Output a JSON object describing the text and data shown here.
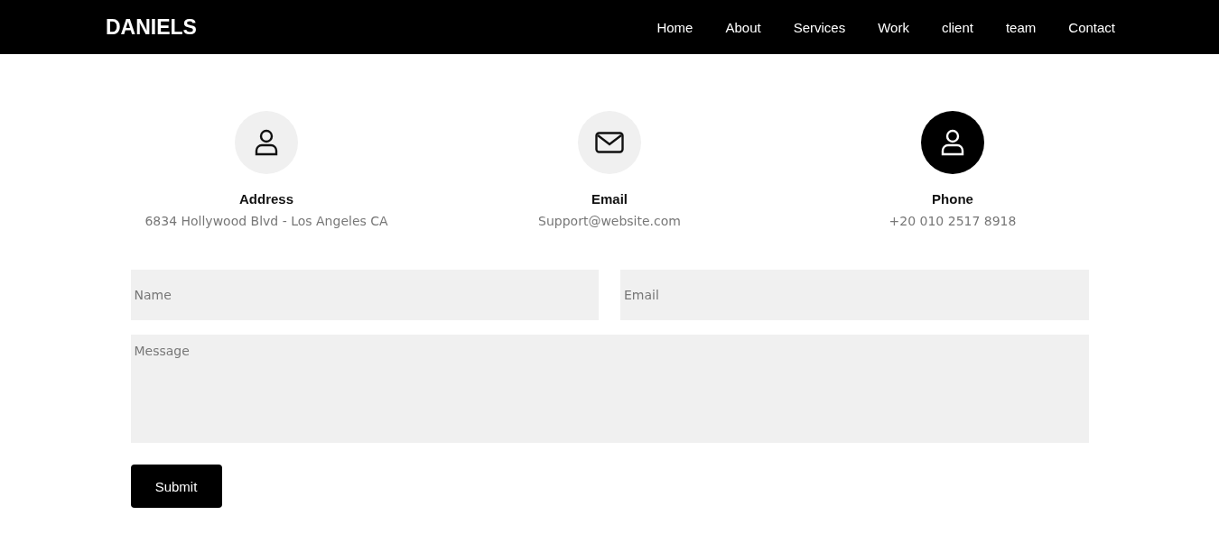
{
  "navbar": {
    "logo": "DANIELS",
    "links": [
      {
        "label": "Home"
      },
      {
        "label": "About"
      },
      {
        "label": "Services"
      },
      {
        "label": "Work"
      },
      {
        "label": "client"
      },
      {
        "label": "team"
      },
      {
        "label": "Contact"
      }
    ]
  },
  "contact_info": [
    {
      "kind": "person",
      "title": "Address",
      "text": "6834 Hollywood Blvd - Los Angeles CA",
      "highlighted": false
    },
    {
      "kind": "mail",
      "title": "Email",
      "text": "Support@website.com",
      "highlighted": false
    },
    {
      "kind": "person",
      "title": "Phone",
      "text": "+20 010 2517 8918",
      "highlighted": true
    }
  ],
  "form": {
    "name": {
      "placeholder": "Name"
    },
    "email": {
      "placeholder": "Email"
    },
    "message": {
      "placeholder": "Message"
    },
    "submit": "Submit"
  }
}
